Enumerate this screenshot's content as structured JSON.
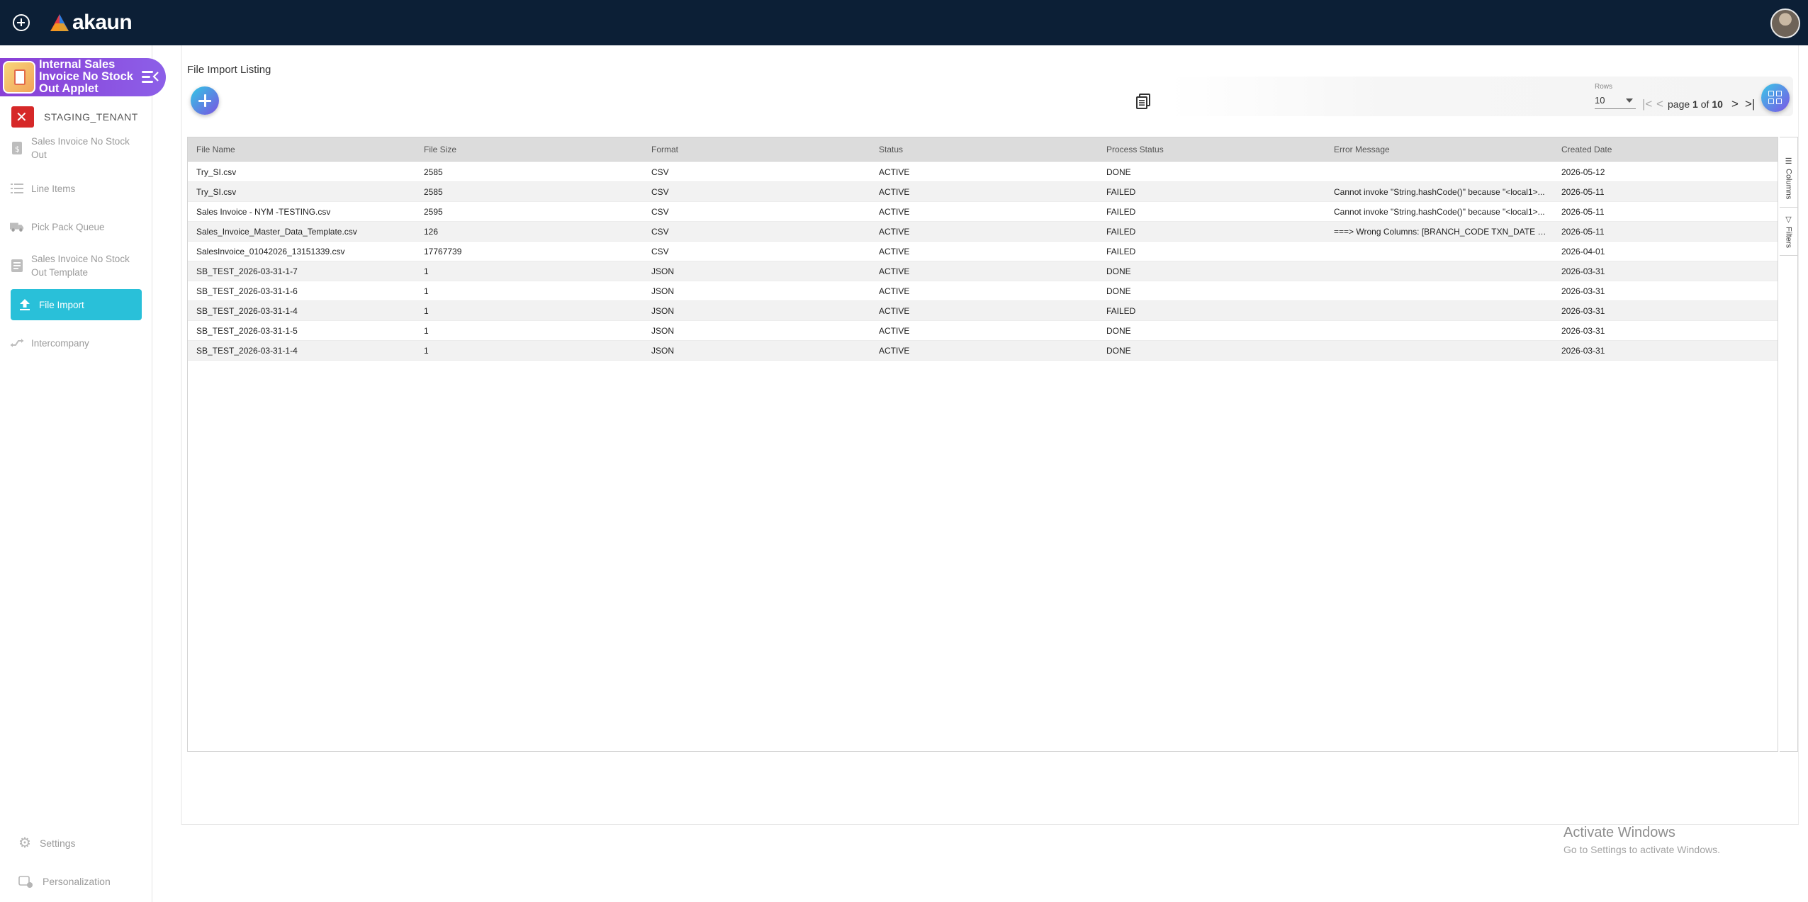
{
  "app": {
    "brand": "akaun"
  },
  "applet": {
    "title": "Internal Sales Invoice No Stock Out Applet"
  },
  "tenant": {
    "name": "STAGING_TENANT"
  },
  "sidebar": {
    "items": [
      {
        "label": "Sales Invoice No Stock Out",
        "icon": "invoice-icon"
      },
      {
        "label": "Line Items",
        "icon": "list-icon"
      },
      {
        "label": "Pick Pack Queue",
        "icon": "truck-icon"
      },
      {
        "label": "Sales Invoice No Stock Out Template",
        "icon": "template-icon"
      },
      {
        "label": "File Import",
        "icon": "upload-icon",
        "active": true
      },
      {
        "label": "Intercompany",
        "icon": "transfer-icon"
      }
    ],
    "bottom": [
      {
        "label": "Settings",
        "icon": "gear-icon"
      },
      {
        "label": "Personalization",
        "icon": "personalization-icon"
      }
    ]
  },
  "page": {
    "title": "File Import Listing"
  },
  "pager": {
    "rows_label": "Rows",
    "rows_value": "10",
    "page_word": "page",
    "current": "1",
    "of_word": "of",
    "total": "10"
  },
  "table": {
    "columns": [
      "File Name",
      "File Size",
      "Format",
      "Status",
      "Process Status",
      "Error Message",
      "Created Date"
    ],
    "rows": [
      [
        "Try_SI.csv",
        "2585",
        "CSV",
        "ACTIVE",
        "DONE",
        "",
        "2026-05-12"
      ],
      [
        "Try_SI.csv",
        "2585",
        "CSV",
        "ACTIVE",
        "FAILED",
        "Cannot invoke \"String.hashCode()\" because \"<local1>...",
        "2026-05-11"
      ],
      [
        "Sales Invoice - NYM -TESTING.csv",
        "2595",
        "CSV",
        "ACTIVE",
        "FAILED",
        "Cannot invoke \"String.hashCode()\" because \"<local1>...",
        "2026-05-11"
      ],
      [
        "Sales_Invoice_Master_Data_Template.csv",
        "126",
        "CSV",
        "ACTIVE",
        "FAILED",
        "===> Wrong Columns: [BRANCH_CODE TXN_DATE H...",
        "2026-05-11"
      ],
      [
        "SalesInvoice_01042026_13151339.csv",
        "17767739",
        "CSV",
        "ACTIVE",
        "FAILED",
        "",
        "2026-04-01"
      ],
      [
        "SB_TEST_2026-03-31-1-7",
        "1",
        "JSON",
        "ACTIVE",
        "DONE",
        "",
        "2026-03-31"
      ],
      [
        "SB_TEST_2026-03-31-1-6",
        "1",
        "JSON",
        "ACTIVE",
        "DONE",
        "",
        "2026-03-31"
      ],
      [
        "SB_TEST_2026-03-31-1-4",
        "1",
        "JSON",
        "ACTIVE",
        "FAILED",
        "",
        "2026-03-31"
      ],
      [
        "SB_TEST_2026-03-31-1-5",
        "1",
        "JSON",
        "ACTIVE",
        "DONE",
        "",
        "2026-03-31"
      ],
      [
        "SB_TEST_2026-03-31-1-4",
        "1",
        "JSON",
        "ACTIVE",
        "DONE",
        "",
        "2026-03-31"
      ]
    ]
  },
  "side_panel": {
    "columns_label": "Columns",
    "filters_label": "Filters"
  },
  "watermark": {
    "title": "Activate Windows",
    "subtitle": "Go to Settings to activate Windows."
  },
  "colors": {
    "topbar": "#0c1f36",
    "active_nav": "#29c0d9",
    "applet_banner": "#8a3fd6",
    "header_row": "#dcdcdc"
  }
}
